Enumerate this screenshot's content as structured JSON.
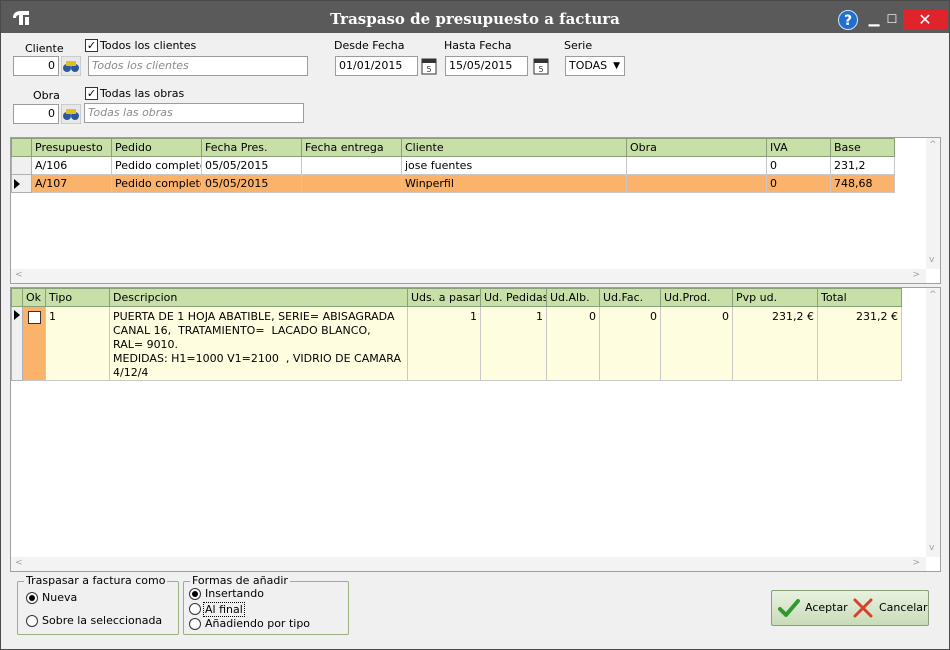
{
  "window": {
    "title": "Traspaso de presupuesto a factura"
  },
  "titlebar_icons": [
    "app-icon",
    "help-icon",
    "minimize-icon",
    "maximize-icon",
    "close-icon"
  ],
  "filters": {
    "cliente_label": "Cliente",
    "cliente_value": "0",
    "todos_clientes_label": "Todos los clientes",
    "todos_clientes_checked": true,
    "cliente_name_placeholder": "Todos los clientes",
    "obra_label": "Obra",
    "obra_value": "0",
    "todas_obras_label": "Todas las obras",
    "todas_obras_checked": true,
    "obra_name_placeholder": "Todas las obras",
    "desde_label": "Desde Fecha",
    "desde_value": "01/01/2015",
    "hasta_label": "Hasta Fecha",
    "hasta_value": "15/05/2015",
    "serie_label": "Serie",
    "serie_value": "TODAS"
  },
  "presupuestos": {
    "columns": [
      "Presupuesto",
      "Pedido",
      "Fecha Pres.",
      "Fecha entrega",
      "Cliente",
      "Obra",
      "IVA",
      "Base"
    ],
    "rows": [
      {
        "presupuesto": "A/106",
        "pedido": "Pedido completo",
        "fecha_pres": "05/05/2015",
        "fecha_entrega": "",
        "cliente": "jose fuentes",
        "obra": "",
        "iva": "0",
        "base": "231,2",
        "selected": false
      },
      {
        "presupuesto": "A/107",
        "pedido": "Pedido completo",
        "fecha_pres": "05/05/2015",
        "fecha_entrega": "",
        "cliente": "Winperfil",
        "obra": "",
        "iva": "0",
        "base": "748,68",
        "selected": true
      }
    ]
  },
  "lineas": {
    "columns": [
      "Ok",
      "Tipo",
      "Descripcion",
      "Uds. a pasar",
      "Ud. Pedidas",
      "Ud.Alb.",
      "Ud.Fac.",
      "Ud.Prod.",
      "Pvp ud.",
      "Total"
    ],
    "rows": [
      {
        "ok": false,
        "tipo": "1",
        "descripcion": "PUERTA DE 1 HOJA ABATIBLE, SERIE= ABISAGRADA CANAL 16,  TRATAMIENTO=  LACADO BLANCO, RAL= 9010.\nMEDIDAS: H1=1000 V1=2100  , VIDRIO DE CAMARA 4/12/4",
        "uds_pasar": "1",
        "ud_pedidas": "1",
        "ud_alb": "0",
        "ud_fac": "0",
        "ud_prod": "0",
        "pvp_ud": "231,2 €",
        "total": "231,2 €"
      }
    ]
  },
  "traspasar": {
    "title": "Traspasar a factura como",
    "options": [
      "Nueva",
      "Sobre la seleccionada"
    ],
    "selected": "Nueva"
  },
  "formas": {
    "title": "Formas de añadir",
    "options": [
      "Insertando",
      "Al final",
      "Añadiendo por tipo"
    ],
    "selected": "Insertando"
  },
  "buttons": {
    "accept": "Aceptar",
    "cancel": "Cancelar"
  },
  "colors": {
    "titlebar": "#5a5a5a",
    "grid_header": "#c8e0a8",
    "selected_row": "#fbb26a",
    "detail_row": "#fffde0",
    "close_button": "#e0242b"
  }
}
